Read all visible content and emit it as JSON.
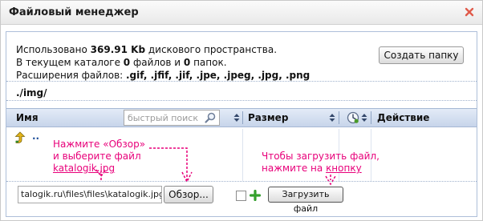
{
  "window": {
    "title": "Файловый менеджер"
  },
  "info": {
    "used_prefix": "Использовано ",
    "used_value": "369.91 Kb",
    "used_suffix": " дискового пространства.",
    "catalog_prefix": "В текущем каталоге ",
    "files_count": "0",
    "files_word": " файлов и ",
    "folders_count": "0",
    "folders_word": " папок.",
    "ext_label": "Расширения файлов: ",
    "ext_list": ".gif, .jfif, .jif, .jpe, .jpeg, .jpg, .png"
  },
  "toolbar": {
    "create_folder_label": "Создать папку"
  },
  "path": "./img/",
  "table": {
    "col_name": "Имя",
    "search_placeholder": "быстрый поиск",
    "col_size": "Размер",
    "col_action": "Действие"
  },
  "up_row": {
    "link": ".."
  },
  "annotations": {
    "browse_hint_line1": "Нажмите «Обзор»",
    "browse_hint_line2": "и выберите файл",
    "browse_hint_line3": "katalogik.jpg",
    "upload_hint_line1": "Чтобы загрузить файл,",
    "upload_hint_line2_prefix": "нажмите на ",
    "upload_hint_line2_link": "кнопку"
  },
  "upload": {
    "file_value": "talogik.ru\\files\\files\\katalogik.jpg",
    "browse_label": "Обзор...",
    "upload_label": "Загрузить файл"
  },
  "colors": {
    "accent_pink": "#e8007a",
    "header_blue": "#c7d5ea",
    "link_blue": "#1f4f9a"
  }
}
